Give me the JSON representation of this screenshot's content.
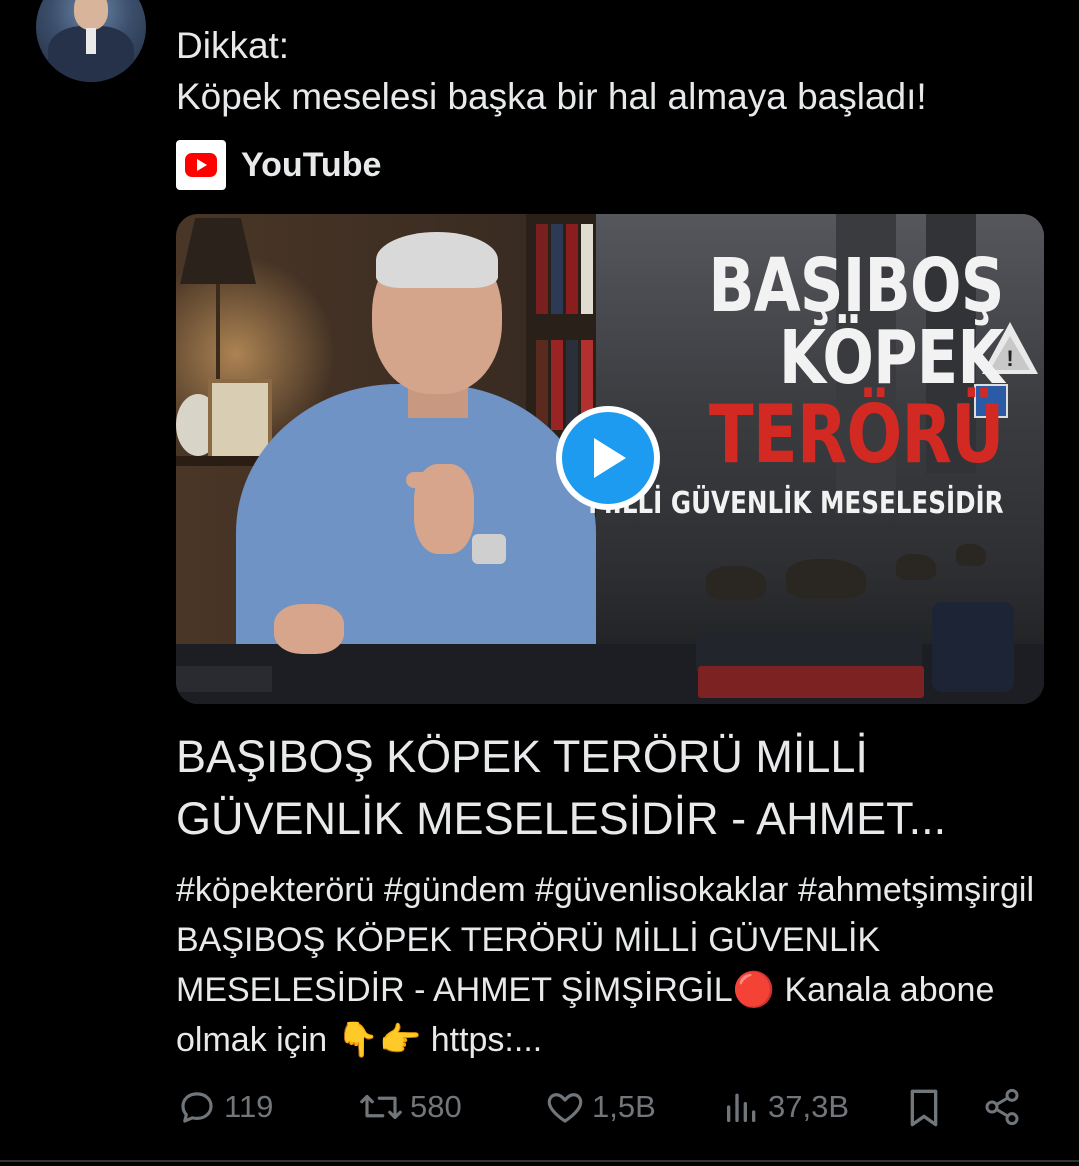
{
  "tweet": {
    "text": "Dikkat:\nKöpek meselesi başka bir hal almaya başladı!"
  },
  "card": {
    "source_name": "YouTube",
    "thumbnail_text": {
      "line1": "BAŞIBOŞ",
      "line2": "KÖPEK",
      "line3": "TERÖRÜ",
      "line4": "MİLLİ GÜVENLİK MESELESİDİR"
    },
    "title": "BAŞIBOŞ KÖPEK TERÖRÜ MİLLİ GÜVENLİK MESELESİDİR - AHMET...",
    "description": "#köpekterörü #gündem #güvenlisokaklar #ahmetşimşirgil BAŞIBOŞ KÖPEK TERÖRÜ MİLLİ GÜVENLİK MESELESİDİR - AHMET ŞİMŞİRGİL🔴 Kanala abone olmak için 👇👉 https:..."
  },
  "actions": {
    "replies": "119",
    "reposts": "580",
    "likes": "1,5B",
    "views": "37,3B"
  },
  "icons": {
    "reply": "reply-icon",
    "repost": "repost-icon",
    "like": "heart-icon",
    "views": "views-icon",
    "bookmark": "bookmark-icon",
    "share": "share-icon",
    "source": "youtube-icon",
    "play": "play-icon"
  },
  "colors": {
    "background": "#000000",
    "text": "#e7e9ea",
    "muted": "#71767b",
    "accent": "#1d9bf0",
    "youtube_red": "#ff0000"
  }
}
